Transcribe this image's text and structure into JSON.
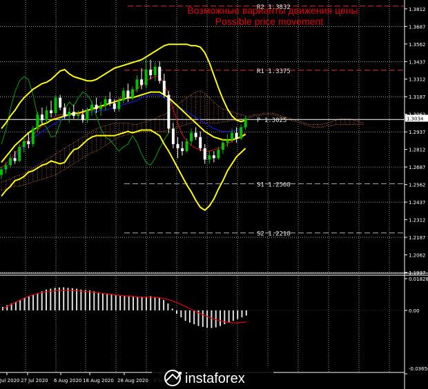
{
  "header": {
    "title_ru": "Возможные варианты движения цены",
    "title_en": "Possible price movement"
  },
  "brand": {
    "name": "instaforex",
    "logo_icon": "instaforex-logo-icon"
  },
  "colors": {
    "background": "#000000",
    "bullish_candle": "#00c000",
    "bearish_candle": "#ffffff",
    "bollinger": "#ffff00",
    "ichimoku_cloud": "#d0742a",
    "kijun": "#1a1ad0",
    "tenkan": "#c01010",
    "chikou": "#00a000",
    "level_line": "#e03030",
    "pivot_line": "#ffffff",
    "macd_hist": "#e0e0e0",
    "macd_signal": "#e00000",
    "title": "#e00000"
  },
  "chart_data": [
    {
      "type": "candlestick",
      "instrument_price_axis": {
        "ticks": [
          "1.3812",
          "1.3687",
          "1.3562",
          "1.3437",
          "1.3312",
          "1.3187",
          "1.3062",
          "1.2937",
          "1.2812",
          "1.2687",
          "1.2562",
          "1.2437",
          "1.2312",
          "1.2187",
          "1.2062",
          "1.1937"
        ],
        "ylim": [
          1.1937,
          1.3875
        ]
      },
      "current_price": {
        "label": "1.3034",
        "value": 1.3034
      },
      "x_tick_labels": [
        "Jul 2020",
        "27 Jul 2020",
        "6 Aug 2020",
        "18 Aug 2020",
        "28 Aug 2020",
        "9 Sep 2020"
      ],
      "levels": [
        {
          "name": "R2",
          "label": "R2 1.3832",
          "value": 1.3832,
          "style": "dashed-red"
        },
        {
          "name": "R1",
          "label": "R1 1.3375",
          "value": 1.3375,
          "style": "dashed-red"
        },
        {
          "name": "P",
          "label": "P 1.3025",
          "value": 1.3025,
          "style": "solid-white"
        },
        {
          "name": "S1",
          "label": "S1 1.2568",
          "value": 1.2568,
          "style": "dashed-white"
        },
        {
          "name": "S2",
          "label": "S2 1.2218",
          "value": 1.2218,
          "style": "dashed-white"
        }
      ],
      "candles": [
        [
          1.263,
          1.269,
          1.26,
          1.267
        ],
        [
          1.267,
          1.272,
          1.264,
          1.27
        ],
        [
          1.27,
          1.278,
          1.268,
          1.275
        ],
        [
          1.275,
          1.28,
          1.271,
          1.273
        ],
        [
          1.273,
          1.285,
          1.272,
          1.283
        ],
        [
          1.283,
          1.29,
          1.279,
          1.287
        ],
        [
          1.287,
          1.293,
          1.282,
          1.285
        ],
        [
          1.285,
          1.298,
          1.283,
          1.296
        ],
        [
          1.296,
          1.308,
          1.294,
          1.306
        ],
        [
          1.306,
          1.311,
          1.299,
          1.302
        ],
        [
          1.302,
          1.312,
          1.3,
          1.309
        ],
        [
          1.309,
          1.316,
          1.304,
          1.307
        ],
        [
          1.307,
          1.32,
          1.305,
          1.318
        ],
        [
          1.318,
          1.32,
          1.309,
          1.311
        ],
        [
          1.311,
          1.314,
          1.303,
          1.305
        ],
        [
          1.305,
          1.311,
          1.3,
          1.308
        ],
        [
          1.308,
          1.313,
          1.303,
          1.305
        ],
        [
          1.305,
          1.309,
          1.302,
          1.306
        ],
        [
          1.306,
          1.31,
          1.3,
          1.302
        ],
        [
          1.302,
          1.311,
          1.3,
          1.309
        ],
        [
          1.309,
          1.316,
          1.305,
          1.313
        ],
        [
          1.313,
          1.318,
          1.307,
          1.31
        ],
        [
          1.31,
          1.315,
          1.305,
          1.312
        ],
        [
          1.312,
          1.319,
          1.309,
          1.317
        ],
        [
          1.317,
          1.322,
          1.312,
          1.314
        ],
        [
          1.314,
          1.317,
          1.308,
          1.31
        ],
        [
          1.31,
          1.318,
          1.308,
          1.316
        ],
        [
          1.316,
          1.325,
          1.314,
          1.323
        ],
        [
          1.323,
          1.328,
          1.315,
          1.318
        ],
        [
          1.318,
          1.326,
          1.316,
          1.324
        ],
        [
          1.324,
          1.334,
          1.322,
          1.331
        ],
        [
          1.331,
          1.339,
          1.324,
          1.327
        ],
        [
          1.327,
          1.346,
          1.325,
          1.338
        ],
        [
          1.338,
          1.345,
          1.331,
          1.334
        ],
        [
          1.334,
          1.343,
          1.33,
          1.34
        ],
        [
          1.34,
          1.344,
          1.328,
          1.33
        ],
        [
          1.33,
          1.335,
          1.318,
          1.32
        ],
        [
          1.32,
          1.323,
          1.293,
          1.296
        ],
        [
          1.296,
          1.3,
          1.282,
          1.285
        ],
        [
          1.285,
          1.29,
          1.275,
          1.282
        ],
        [
          1.282,
          1.287,
          1.277,
          1.28
        ],
        [
          1.28,
          1.289,
          1.279,
          1.287
        ],
        [
          1.287,
          1.296,
          1.284,
          1.293
        ],
        [
          1.293,
          1.297,
          1.288,
          1.29
        ],
        [
          1.29,
          1.294,
          1.28,
          1.282
        ],
        [
          1.282,
          1.285,
          1.271,
          1.274
        ],
        [
          1.274,
          1.28,
          1.271,
          1.277
        ],
        [
          1.277,
          1.28,
          1.272,
          1.275
        ],
        [
          1.275,
          1.283,
          1.274,
          1.281
        ],
        [
          1.281,
          1.289,
          1.278,
          1.286
        ],
        [
          1.286,
          1.292,
          1.283,
          1.288
        ],
        [
          1.288,
          1.296,
          1.286,
          1.293
        ],
        [
          1.293,
          1.297,
          1.286,
          1.289
        ],
        [
          1.289,
          1.299,
          1.288,
          1.297
        ],
        [
          1.297,
          1.305,
          1.295,
          1.3034
        ]
      ],
      "bollinger_upper": [
        1.296,
        1.3,
        1.305,
        1.309,
        1.314,
        1.318,
        1.321,
        1.324,
        1.326,
        1.328,
        1.329,
        1.331,
        1.334,
        1.337,
        1.338,
        1.335,
        1.333,
        1.332,
        1.331,
        1.33,
        1.33,
        1.331,
        1.333,
        1.335,
        1.337,
        1.339,
        1.34,
        1.341,
        1.342,
        1.343,
        1.344,
        1.345,
        1.347,
        1.349,
        1.351,
        1.353,
        1.355,
        1.356,
        1.356,
        1.356,
        1.356,
        1.356,
        1.355,
        1.355,
        1.354,
        1.35,
        1.343,
        1.334,
        1.325,
        1.317,
        1.31,
        1.305,
        1.302,
        1.301,
        1.302
      ],
      "bollinger_middle": [
        1.272,
        1.276,
        1.28,
        1.284,
        1.287,
        1.29,
        1.293,
        1.295,
        1.297,
        1.299,
        1.3,
        1.302,
        1.303,
        1.304,
        1.305,
        1.306,
        1.307,
        1.307,
        1.308,
        1.309,
        1.31,
        1.311,
        1.312,
        1.313,
        1.314,
        1.315,
        1.316,
        1.317,
        1.318,
        1.318,
        1.319,
        1.32,
        1.321,
        1.322,
        1.322,
        1.322,
        1.32,
        1.318,
        1.315,
        1.312,
        1.309,
        1.306,
        1.303,
        1.3,
        1.297,
        1.294,
        1.292,
        1.29,
        1.289,
        1.288,
        1.288,
        1.288,
        1.289,
        1.29,
        1.292
      ],
      "bollinger_lower": [
        1.248,
        1.252,
        1.255,
        1.259,
        1.26,
        1.262,
        1.265,
        1.266,
        1.268,
        1.27,
        1.271,
        1.273,
        1.272,
        1.271,
        1.272,
        1.277,
        1.281,
        1.282,
        1.285,
        1.288,
        1.29,
        1.291,
        1.291,
        1.291,
        1.291,
        1.291,
        1.292,
        1.293,
        1.294,
        1.293,
        1.294,
        1.295,
        1.295,
        1.295,
        1.293,
        1.291,
        1.285,
        1.28,
        1.274,
        1.268,
        1.262,
        1.256,
        1.251,
        1.245,
        1.24,
        1.238,
        1.241,
        1.246,
        1.253,
        1.259,
        1.266,
        1.271,
        1.276,
        1.279,
        1.282
      ],
      "kijun": [
        1.266,
        1.269,
        1.272,
        1.276,
        1.28,
        1.283,
        1.286,
        1.289,
        1.292,
        1.294,
        1.296,
        1.298,
        1.3,
        1.302,
        1.304,
        1.305,
        1.306,
        1.306,
        1.307,
        1.307,
        1.308,
        1.308,
        1.309,
        1.309,
        1.31,
        1.311,
        1.312,
        1.313,
        1.314,
        1.315,
        1.316,
        1.318,
        1.319,
        1.32,
        1.32,
        1.32,
        1.318,
        1.316,
        1.314,
        1.312,
        1.31,
        1.308,
        1.306,
        1.304,
        1.302,
        1.3,
        1.298,
        1.296,
        1.295,
        1.294,
        1.294,
        1.294,
        1.295,
        1.296,
        1.298
      ],
      "tenkan": [
        1.268,
        1.271,
        1.274,
        1.278,
        1.282,
        1.285,
        1.288,
        1.291,
        1.295,
        1.298,
        1.3,
        1.302,
        1.305,
        1.306,
        1.306,
        1.306,
        1.306,
        1.306,
        1.307,
        1.308,
        1.309,
        1.31,
        1.311,
        1.312,
        1.314,
        1.315,
        1.317,
        1.319,
        1.321,
        1.322,
        1.324,
        1.327,
        1.33,
        1.332,
        1.333,
        1.333,
        1.328,
        1.32,
        1.31,
        1.3,
        1.292,
        1.287,
        1.284,
        1.282,
        1.281,
        1.28,
        1.28,
        1.281,
        1.282,
        1.283,
        1.285,
        1.287,
        1.289,
        1.291,
        1.293
      ],
      "cloud_a": [
        1.258,
        1.259,
        1.26,
        1.262,
        1.263,
        1.264,
        1.266,
        1.268,
        1.27,
        1.272,
        1.274,
        1.276,
        1.278,
        1.28,
        1.282,
        1.284,
        1.286,
        1.288,
        1.29,
        1.292,
        1.294,
        1.296,
        1.297,
        1.298,
        1.299,
        1.3,
        1.3,
        1.3,
        1.3,
        1.299,
        1.299,
        1.3,
        1.301,
        1.302,
        1.303,
        1.305,
        1.306,
        1.308,
        1.311,
        1.313,
        1.316,
        1.318,
        1.32,
        1.322,
        1.323,
        1.321,
        1.318,
        1.315,
        1.312,
        1.31,
        1.309,
        1.308,
        1.307,
        1.306,
        1.305,
        1.305,
        1.306,
        1.306,
        1.307,
        1.307,
        1.307,
        1.306,
        1.305,
        1.304,
        1.303,
        1.302,
        1.301,
        1.3,
        1.299,
        1.299,
        1.299,
        1.299,
        1.3,
        1.301,
        1.302,
        1.303,
        1.303,
        1.303,
        1.302,
        1.301,
        1.3
      ],
      "cloud_b": [
        1.252,
        1.253,
        1.254,
        1.255,
        1.255,
        1.256,
        1.257,
        1.258,
        1.259,
        1.26,
        1.261,
        1.262,
        1.263,
        1.265,
        1.267,
        1.269,
        1.271,
        1.273,
        1.275,
        1.277,
        1.279,
        1.28,
        1.282,
        1.284,
        1.286,
        1.288,
        1.29,
        1.291,
        1.292,
        1.293,
        1.293,
        1.294,
        1.294,
        1.294,
        1.294,
        1.294,
        1.294,
        1.295,
        1.296,
        1.297,
        1.298,
        1.299,
        1.3,
        1.3,
        1.3,
        1.3,
        1.3,
        1.3,
        1.3,
        1.301,
        1.301,
        1.302,
        1.302,
        1.303,
        1.303,
        1.304,
        1.305,
        1.305,
        1.306,
        1.306,
        1.306,
        1.305,
        1.304,
        1.303,
        1.302,
        1.301,
        1.3,
        1.299,
        1.298,
        1.297,
        1.297,
        1.297,
        1.298,
        1.298,
        1.299,
        1.299,
        1.299,
        1.299,
        1.299,
        1.299,
        1.299
      ],
      "chikou": [
        1.285,
        1.295,
        1.31,
        1.322,
        1.33,
        1.333,
        1.331,
        1.32,
        1.305,
        1.3,
        1.297,
        1.29,
        1.291,
        1.3,
        1.31,
        1.315,
        1.312,
        1.318,
        1.322,
        1.32,
        1.315,
        1.305,
        1.296,
        1.29,
        1.288,
        1.284,
        1.28,
        1.283,
        1.285,
        1.291,
        1.286,
        1.278,
        1.272,
        1.27,
        1.275,
        1.282,
        1.288,
        1.293
      ]
    },
    {
      "type": "macd",
      "ticks": [
        "0.01828",
        "0.00",
        "-0.03656"
      ],
      "ylim": [
        -0.03656,
        0.01828
      ],
      "histogram": [
        0.002,
        0.003,
        0.004,
        0.005,
        0.006,
        0.007,
        0.008,
        0.009,
        0.01,
        0.011,
        0.012,
        0.0125,
        0.013,
        0.0132,
        0.0133,
        0.013,
        0.0128,
        0.0125,
        0.012,
        0.0118,
        0.0115,
        0.011,
        0.0105,
        0.01,
        0.0098,
        0.0095,
        0.009,
        0.0088,
        0.0085,
        0.0085,
        0.0082,
        0.008,
        0.0078,
        0.008,
        0.0082,
        0.0078,
        0.0072,
        0.006,
        0.004,
        0.001,
        -0.002,
        -0.004,
        -0.006,
        -0.007,
        -0.008,
        -0.009,
        -0.0095,
        -0.01,
        -0.0102,
        -0.0098,
        -0.009,
        -0.008,
        -0.007,
        -0.006,
        -0.005,
        -0.004,
        -0.003
      ],
      "signal": [
        0.001,
        0.0022,
        0.0035,
        0.0048,
        0.006,
        0.0072,
        0.0082,
        0.009,
        0.0097,
        0.0102,
        0.0107,
        0.011,
        0.0112,
        0.0114,
        0.0115,
        0.0115,
        0.0114,
        0.0113,
        0.0111,
        0.0109,
        0.0107,
        0.0104,
        0.0101,
        0.0098,
        0.0095,
        0.0092,
        0.0089,
        0.0086,
        0.0084,
        0.0082,
        0.008,
        0.0078,
        0.0077,
        0.0076,
        0.0076,
        0.0075,
        0.0073,
        0.0069,
        0.0063,
        0.0055,
        0.0045,
        0.0034,
        0.0022,
        0.001,
        -0.0002,
        -0.0014,
        -0.0025,
        -0.0035,
        -0.0045,
        -0.0053,
        -0.006,
        -0.0066,
        -0.007,
        -0.0072,
        -0.0072,
        -0.007,
        -0.0066
      ]
    }
  ]
}
